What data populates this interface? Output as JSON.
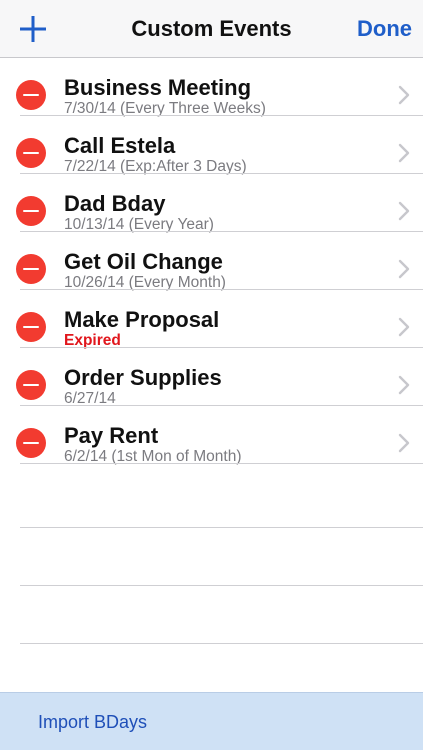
{
  "navbar": {
    "add_icon": "plus-icon",
    "title": "Custom Events",
    "done_label": "Done",
    "accent_color": "#1f5ec9"
  },
  "events": [
    {
      "title": "Business Meeting",
      "subtitle": "7/30/14  (Every Three Weeks)",
      "expired": false
    },
    {
      "title": "Call Estela",
      "subtitle": "7/22/14  (Exp:After 3 Days)",
      "expired": false
    },
    {
      "title": "Dad Bday",
      "subtitle": "10/13/14  (Every Year)",
      "expired": false
    },
    {
      "title": "Get Oil Change",
      "subtitle": "10/26/14  (Every Month)",
      "expired": false
    },
    {
      "title": "Make Proposal",
      "subtitle": "Expired",
      "expired": true
    },
    {
      "title": "Order Supplies",
      "subtitle": "6/27/14",
      "expired": false
    },
    {
      "title": "Pay Rent",
      "subtitle": "6/2/14  (1st Mon of Month)",
      "expired": false
    }
  ],
  "delete_icon": "minus-circle-icon",
  "row_chevron_icon": "chevron-right-icon",
  "delete_color": "#f23b30",
  "expired_color": "#e1161c",
  "bottom": {
    "import_label": "Import BDays",
    "bar_color": "#cfe1f5"
  }
}
